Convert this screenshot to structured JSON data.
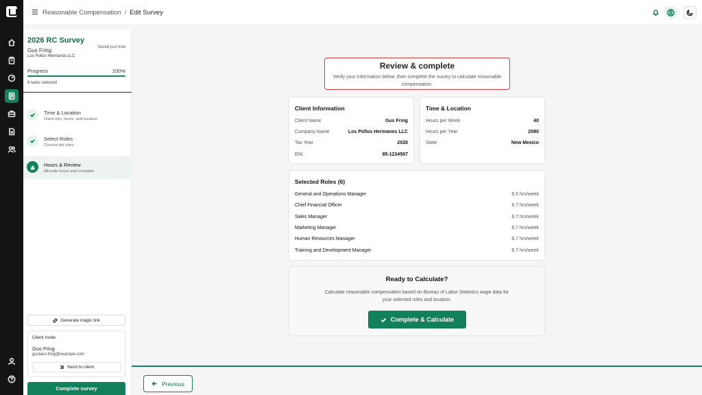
{
  "breadcrumb": {
    "parent": "Reasonable Compensation",
    "separator": "/",
    "current": "Edit Survey"
  },
  "rail": {
    "icons": [
      "logo-icon",
      "home-icon",
      "clipboard-icon",
      "gauge-icon",
      "survey-icon",
      "briefcase-icon",
      "document-icon",
      "users-icon",
      "profile-icon",
      "help-icon"
    ],
    "active": "survey-icon"
  },
  "topbar": {
    "icons": [
      "bell-icon",
      "user-circle-icon",
      "moon-icon"
    ]
  },
  "sidebar": {
    "survey_title": "2026 RC Survey",
    "client_name": "Gus Fring",
    "company": "Los Pollos Hermanos LLC",
    "saved_status": "Saved just now",
    "progress_label": "Progress",
    "progress_percent": "100%",
    "progress_value": 1.0,
    "tasks_selected": "6 tasks selected",
    "steps": [
      {
        "title": "Time & Location",
        "subtitle": "Client info, hours, and location",
        "icon": "check-icon"
      },
      {
        "title": "Select Roles",
        "subtitle": "Choose job roles",
        "icon": "check-icon"
      },
      {
        "title": "Hours & Review",
        "subtitle": "Allocate hours and complete",
        "icon": "chart-icon"
      }
    ],
    "magic_link_label": "Generate magic link",
    "invite": {
      "title": "Client Invite",
      "name": "Gus Fring",
      "email": "gustavo.fring@example.com",
      "send_label": "Send to client"
    },
    "complete_label": "Complete survey"
  },
  "review": {
    "title": "Review & complete",
    "subtitle": "Verify your information below, then complete the survey to calculate reasonable compensation."
  },
  "client_info": {
    "title": "Client Information",
    "rows": [
      {
        "label": "Client Name",
        "value": "Gus Fring"
      },
      {
        "label": "Company Name",
        "value": "Los Pollos Hermanos LLC"
      },
      {
        "label": "Tax Year",
        "value": "2026"
      },
      {
        "label": "EIN",
        "value": "85-1234567"
      }
    ]
  },
  "time_location": {
    "title": "Time & Location",
    "rows": [
      {
        "label": "Hours per Week",
        "value": "40"
      },
      {
        "label": "Hours per Year",
        "value": "2080"
      },
      {
        "label": "State",
        "value": "New Mexico"
      }
    ]
  },
  "roles": {
    "title": "Selected Roles (6)",
    "items": [
      {
        "name": "General and Operations Manager",
        "hours": "6.5 hrs/week"
      },
      {
        "name": "Chief Financial Officer",
        "hours": "6.7 hrs/week"
      },
      {
        "name": "Sales Manager",
        "hours": "6.7 hrs/week"
      },
      {
        "name": "Marketing Manager",
        "hours": "6.7 hrs/week"
      },
      {
        "name": "Human Resources Manager",
        "hours": "6.7 hrs/week"
      },
      {
        "name": "Training and Development Manager",
        "hours": "6.7 hrs/week"
      }
    ]
  },
  "ready": {
    "title": "Ready to Calculate?",
    "subtitle": "Calculate reasonable compensation based on Bureau of Labor Statistics wage data for your selected roles and location.",
    "button_label": "Complete & Calculate"
  },
  "footer": {
    "previous_label": "Previous"
  },
  "colors": {
    "accent": "#12805a",
    "highlight_border": "#d9363e",
    "rail": "#141414"
  }
}
